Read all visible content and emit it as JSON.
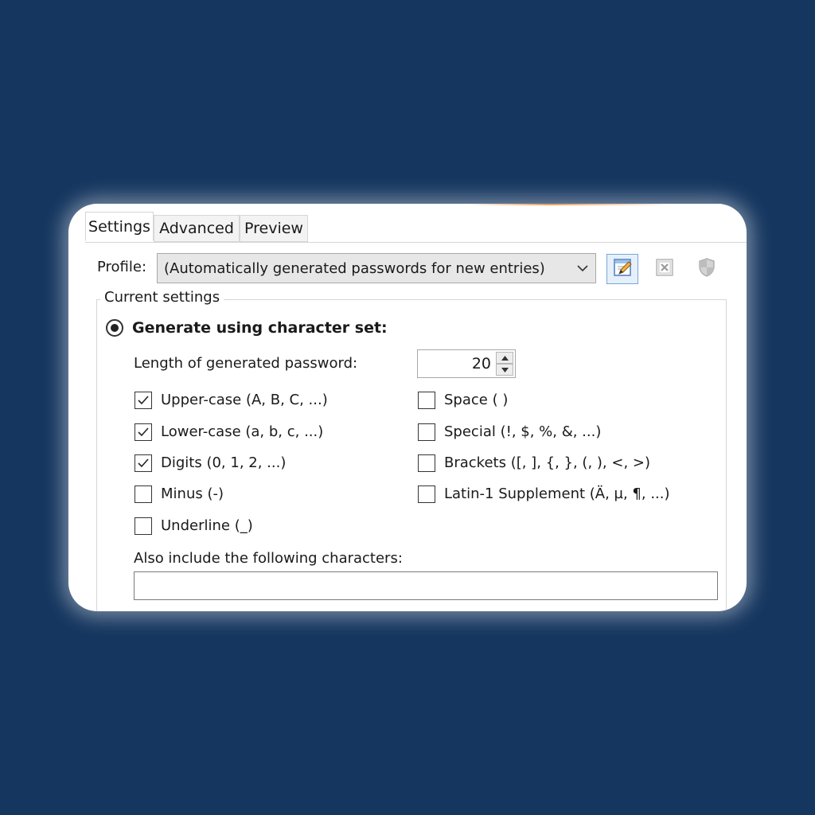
{
  "tabs": [
    {
      "label": "Settings"
    },
    {
      "label": "Advanced"
    },
    {
      "label": "Preview"
    }
  ],
  "profile": {
    "label": "Profile:",
    "selected": "(Automatically generated passwords for new entries)"
  },
  "group": {
    "title": "Current settings",
    "radio_label": "Generate using character set:",
    "radio_checked": true
  },
  "length": {
    "label": "Length of generated password:",
    "value": "20"
  },
  "charsets_left": [
    {
      "label": "Upper-case (A, B, C, ...)",
      "checked": true
    },
    {
      "label": "Lower-case (a, b, c, ...)",
      "checked": true
    },
    {
      "label": "Digits (0, 1, 2, ...)",
      "checked": true
    },
    {
      "label": "Minus (-)",
      "checked": false
    },
    {
      "label": "Underline (_)",
      "checked": false
    }
  ],
  "charsets_right": [
    {
      "label": "Space ( )",
      "checked": false
    },
    {
      "label": "Special (!, $, %, &, ...)",
      "checked": false
    },
    {
      "label": "Brackets ([, ], {, }, (, ), <, >)",
      "checked": false
    },
    {
      "label": "Latin-1 Supplement (Ä, µ, ¶, ...)",
      "checked": false
    }
  ],
  "include": {
    "label": "Also include the following characters:",
    "value": ""
  },
  "icons": {
    "edit": "edit-profile-icon",
    "delete": "delete-profile-icon",
    "shield": "shield-icon"
  },
  "colors": {
    "background": "#15365f",
    "accent": "#f1a05a",
    "selected_button_border": "#7aa6d6"
  }
}
